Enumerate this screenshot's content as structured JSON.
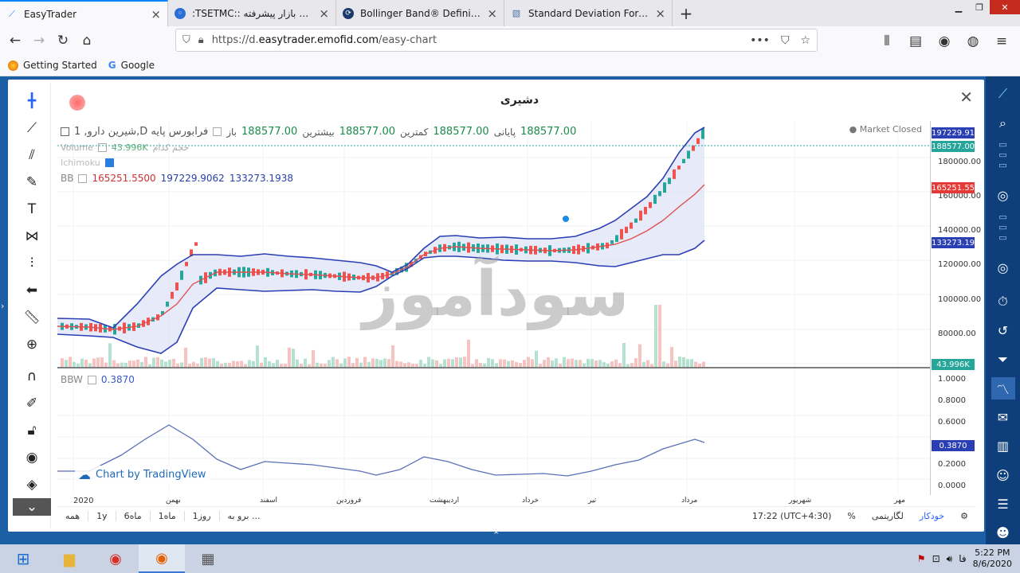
{
  "browser": {
    "tabs": [
      {
        "label": "EasyTrader",
        "active": true,
        "icon": "easytrader-icon"
      },
      {
        "label": ":TSETMC:: ده بان بازار پیشرفته",
        "active": false,
        "icon": "globe-icon"
      },
      {
        "label": "Bollinger Band® Definition",
        "active": false,
        "icon": "investopedia-icon"
      },
      {
        "label": "Standard Deviation Formulas",
        "active": false,
        "icon": "page-icon"
      }
    ],
    "url_prefix": "https://d.",
    "url_domain": "easytrader.emofid.com",
    "url_path": "/easy-chart",
    "bookmarks": [
      {
        "label": "Getting Started",
        "icon": "firefox-icon"
      },
      {
        "label": "Google",
        "icon": "google-icon"
      }
    ]
  },
  "chart": {
    "symbol_title": "دشیری",
    "main_legend": {
      "description": "1 ,شیرین دارو,D فرابورس پایه",
      "open_label": "باز",
      "open_value": "188577.00",
      "high_label": "بیشترین",
      "high_value": "188577.00",
      "low_label": "کمترین",
      "low_value": "188577.00",
      "close_label": "پایانی",
      "close_value": "188577.00"
    },
    "volume_legend": {
      "name": "Volume",
      "extra": "حجم کدام",
      "value": "43.996K"
    },
    "ichimoku_legend": {
      "name": "Ichimoku"
    },
    "bb_legend": {
      "name": "BB",
      "basis": "165251.5500",
      "upper": "197229.9062",
      "lower": "133273.1938"
    },
    "bbw_legend": {
      "name": "BBW",
      "value": "0.3870"
    },
    "market_status": "Market Closed",
    "price_tags": {
      "upper": "197229.91",
      "close": "188577.00",
      "basis": "165251.55",
      "lower": "133273.19",
      "volume": "43.996K",
      "bbw": "0.3870"
    },
    "price_ticks": [
      "180000.00",
      "160000.00",
      "140000.00",
      "120000.00",
      "100000.00",
      "80000.00"
    ],
    "bbw_ticks": [
      "1.0000",
      "0.8000",
      "0.6000",
      "0.4000",
      "0.2000",
      "0.0000"
    ],
    "time_labels": [
      "2020",
      "بهمن",
      "اسفند",
      "فروردین",
      "اردیبهشت",
      "خرداد",
      "تیر",
      "مرداد",
      "شهریور",
      "مهر"
    ],
    "watermark": "سودآموز",
    "brand": "Chart by TradingView",
    "bottom_buttons": [
      "همه",
      "1y",
      "6ماه",
      "1ماه",
      "1روز",
      "برو به ..."
    ],
    "bottom_right": {
      "time": "17:22 (UTC+4:30)",
      "percent": "%",
      "log": "لگاریتمی",
      "auto": "خودکار"
    },
    "colors": {
      "upper_band": "#2b3fb5",
      "lower_band": "#2b3fb5",
      "basis": "#e05050",
      "band_fill": "#dfe3f5",
      "up_candle": "#26a69a",
      "down_candle": "#ef5350"
    }
  },
  "taskbar": {
    "time": "5:22 PM",
    "date": "8/6/2020",
    "lang": "فا"
  }
}
